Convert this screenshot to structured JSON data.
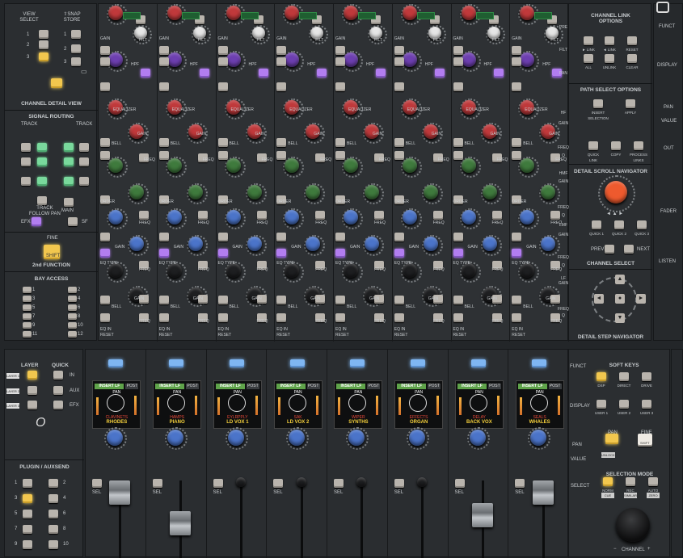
{
  "left_panel": {
    "view_select": "VIEW\nSELECT",
    "snap_store": "⇧SNAP\nSTORE",
    "view_numbers": [
      "1",
      "2",
      "3"
    ],
    "snap_numbers": [
      "1",
      "2",
      "3"
    ],
    "channel_detail_view": "CHANNEL DETAIL VIEW",
    "signal_routing": "SIGNAL ROUTING",
    "track_left": "TRACK",
    "track_right": "TRACK",
    "track_follow_pan": "TRACK\nFOLLOW PAN",
    "main": "MAIN",
    "efx": "EFX",
    "sf": "SF",
    "fine": "FINE",
    "shift": "SHIFT",
    "second_function": "2nd FUNCTION",
    "bay_access": "BAY ACCESS",
    "bay_numbers": [
      "1",
      "2",
      "3",
      "4",
      "5",
      "6",
      "7",
      "8",
      "9",
      "10",
      "11",
      "12"
    ],
    "layer": "LAYER",
    "quick": "QUICK",
    "layer_tags": [
      "LAYER 1",
      "LAYER 2",
      "LAYER 3"
    ],
    "layer_numbers": [
      "1",
      "2",
      "3"
    ],
    "quick_numbers": [
      "1",
      "2",
      "3"
    ],
    "quick_tags": [
      "IN",
      "AUX",
      "EFX"
    ],
    "plugin_auxsend": "PLUGIN / AUXSEND",
    "aux_numbers": [
      "1",
      "2",
      "3",
      "4",
      "5",
      "6",
      "7",
      "8",
      "9",
      "10"
    ]
  },
  "strip_labels": {
    "gain": "GAIN",
    "filt": "FILT",
    "hpf": "HPF",
    "lpf": "LPF",
    "freq": "FREQ",
    "bell": "BELL",
    "order": "ORDER",
    "eq_type": "EQ TYPE",
    "eq_in": "EQ IN",
    "reset": "RESET",
    "equalizer": "EQUALIZER",
    "sel": "SEL",
    "insert_lf": "INSERT LF",
    "post": "POST",
    "pan": "PAN"
  },
  "side_labels": {
    "pre": "PRE",
    "filt": "FILT",
    "pan": "PAN",
    "hf": "HF",
    "gain": "GAIN",
    "freq": "FREQ",
    "hmf": "HMF",
    "lmf": "LMF",
    "lf": "LF",
    "q": "Q",
    "funct": "FUNCT",
    "display": "DISPLAY",
    "value": "VALUE",
    "select": "SELECT"
  },
  "channels": [
    {
      "insert": "INSERT LF",
      "post": "POST",
      "pan": "PAN",
      "slot": "CLAVINETS",
      "name": "RHODES"
    },
    {
      "insert": "INSERT LF",
      "post": "POST",
      "pan": "PAN",
      "slot": "HAMPS",
      "name": "PIANO"
    },
    {
      "insert": "INSERT LF",
      "post": "POST",
      "pan": "PAN",
      "slot": "EYLRPPLY",
      "name": "LD VOX 1"
    },
    {
      "insert": "INSERT LF",
      "post": "POST",
      "pan": "PAN",
      "slot": "SAK",
      "name": "LD VOX 2"
    },
    {
      "insert": "INSERT LF",
      "post": "POST",
      "pan": "PAN",
      "slot": "WIPER",
      "name": "SYNTHS"
    },
    {
      "insert": "INSERT LF",
      "post": "POST",
      "pan": "PAN",
      "slot": "EFFECTS",
      "name": "ORGAN"
    },
    {
      "insert": "INSERT LF",
      "post": "POST",
      "pan": "PAN",
      "slot": "DELAY",
      "name": "BACK VOX"
    },
    {
      "insert": "INSERT LF",
      "post": "POST",
      "pan": "PAN",
      "slot": "SEALS",
      "name": "WHALES"
    }
  ],
  "right_panel": {
    "channel_link_options": "CHANNEL LINK\nOPTIONS",
    "link_buttons": [
      "► LINK",
      "◄ LINK",
      "RESET",
      "ALL",
      "UNLINK",
      "CLEAR"
    ],
    "path_select_options": "PATH SELECT OPTIONS",
    "path_buttons": [
      "INSERT\nSELECTION",
      "APPLY",
      "QUICK\nLINK",
      "COPY",
      "PROCESS\nLINKS"
    ],
    "detail_scroll_navigator": "DETAIL SCROLL NAVIGATOR",
    "quick_buttons": [
      "QUICK 1",
      "QUICK 2",
      "QUICK 3"
    ],
    "prev": "PREV",
    "next": "NEXT",
    "channel_select": "CHANNEL SELECT",
    "detail_step_navigator": "DETAIL STEP NAVIGATOR",
    "soft_keys": "SOFT KEYS",
    "soft_buttons": [
      "DSP",
      "DIRECT",
      "DRIVE",
      "USER 1",
      "USER 2",
      "USER 3"
    ],
    "insert_label": "INSERT",
    "pan_label": "PAN",
    "unlock": "UNLOCK",
    "fine": "FINE",
    "shift": "SHIFT",
    "selection_mode": "SELECTION MODE",
    "sel_buttons": [
      "NORM",
      "REC",
      "AUTO"
    ],
    "sel_sub": [
      "CUE",
      "SIMILAR",
      "ZERO"
    ],
    "channel": "CHANNEL",
    "channel_minus": "−",
    "channel_plus": "+"
  },
  "far_right": {
    "funct": "FUNCT",
    "display": "DISPLAY",
    "pan": "PAN",
    "value": "VALUE",
    "out": "OUT",
    "fader": "FADER",
    "listen": "LISTEN"
  },
  "colors": {
    "yellow_button": "#f2c74e",
    "green_button": "#79d99c",
    "purple_button": "#b27df0",
    "blue_button": "#7fb6f2",
    "orange_knob": "#ee5a2e"
  }
}
